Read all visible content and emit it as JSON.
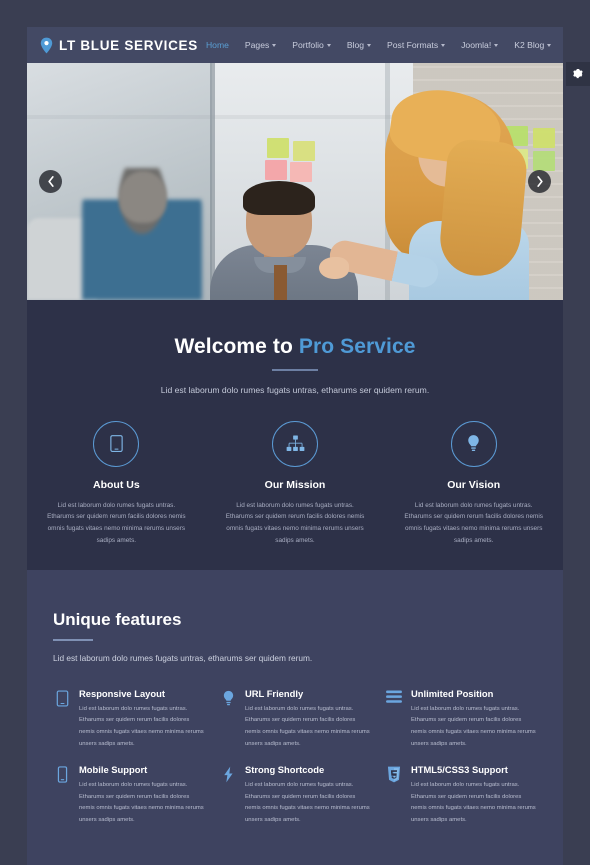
{
  "site": {
    "logo_text": "LT BLUE SERVICES",
    "logo_icon": "location-pin-icon"
  },
  "nav": {
    "items": [
      {
        "label": "Home",
        "has_caret": false,
        "active": true
      },
      {
        "label": "Pages",
        "has_caret": true,
        "active": false
      },
      {
        "label": "Portfolio",
        "has_caret": true,
        "active": false
      },
      {
        "label": "Blog",
        "has_caret": true,
        "active": false
      },
      {
        "label": "Post Formats",
        "has_caret": true,
        "active": false
      },
      {
        "label": "Joomla!",
        "has_caret": true,
        "active": false
      },
      {
        "label": "K2 Blog",
        "has_caret": true,
        "active": false
      }
    ]
  },
  "settings_button": {
    "icon": "gear-icon"
  },
  "slider": {
    "prev_icon": "chevron-left-icon",
    "next_icon": "chevron-right-icon",
    "image_alt": "office team meeting photo"
  },
  "welcome": {
    "title_plain": "Welcome to ",
    "title_accent": "Pro Service",
    "subtitle": "Lid est laborum dolo rumes fugats untras, etharums ser quidem rerum.",
    "columns": [
      {
        "icon": "tablet-icon",
        "title": "About Us",
        "desc": "Lid est laborum dolo rumes fugats untras. Etharums ser quidem rerum facilis dolores nemis omnis fugats vitaes nemo minima rerums unsers sadips amets."
      },
      {
        "icon": "sitemap-icon",
        "title": "Our Mission",
        "desc": "Lid est laborum dolo rumes fugats untras. Etharums ser quidem rerum facilis dolores nemis omnis fugats vitaes nemo minima rerums unsers sadips amets."
      },
      {
        "icon": "lightbulb-icon",
        "title": "Our Vision",
        "desc": "Lid est laborum dolo rumes fugats untras. Etharums ser quidem rerum facilis dolores nemis omnis fugats vitaes nemo minima rerums unsers sadips amets."
      }
    ]
  },
  "features": {
    "heading": "Unique features",
    "subtitle": "Lid est laborum dolo rumes fugats untras, etharums ser quidem rerum.",
    "items": [
      {
        "icon": "tablet-icon",
        "title": "Responsive Layout",
        "desc": "Lid est laborum dolo rumes fugats untras. Etharums ser quidem rerum facilis dolores nemis omnis fugats vitaes nemo minima rerums unsers sadips amets."
      },
      {
        "icon": "lightbulb-icon",
        "title": "URL Friendly",
        "desc": "Lid est laborum dolo rumes fugats untras. Etharums ser quidem rerum facilis dolores nemis omnis fugats vitaes nemo minima rerums unsers sadips amets."
      },
      {
        "icon": "list-bars-icon",
        "title": "Unlimited Position",
        "desc": "Lid est laborum dolo rumes fugats untras. Etharums ser quidem rerum facilis dolores nemis omnis fugats vitaes nemo minima rerums unsers sadips amets."
      },
      {
        "icon": "mobile-phone-icon",
        "title": "Mobile Support",
        "desc": "Lid est laborum dolo rumes fugats untras. Etharums ser quidem rerum facilis dolores nemis omnis fugats vitaes nemo minima rerums unsers sadips amets."
      },
      {
        "icon": "lightning-bolt-icon",
        "title": "Strong Shortcode",
        "desc": "Lid est laborum dolo rumes fugats untras. Etharums ser quidem rerum facilis dolores nemis omnis fugats vitaes nemo minima rerums unsers sadips amets."
      },
      {
        "icon": "html5-shield-icon",
        "title": "HTML5/CSS3 Support",
        "desc": "Lid est laborum dolo rumes fugats untras. Etharums ser quidem rerum facilis dolores nemis omnis fugats vitaes nemo minima rerums unsers sadips amets."
      }
    ]
  },
  "colors": {
    "page_bg": "#3a3e52",
    "header_bg": "#434964",
    "welcome_bg": "#2d3148",
    "features_bg": "#3e4360",
    "accent_blue": "#4f9ad6",
    "icon_blue": "#6ba6df",
    "text_white": "#ffffff",
    "text_muted": "#b9bed0"
  }
}
